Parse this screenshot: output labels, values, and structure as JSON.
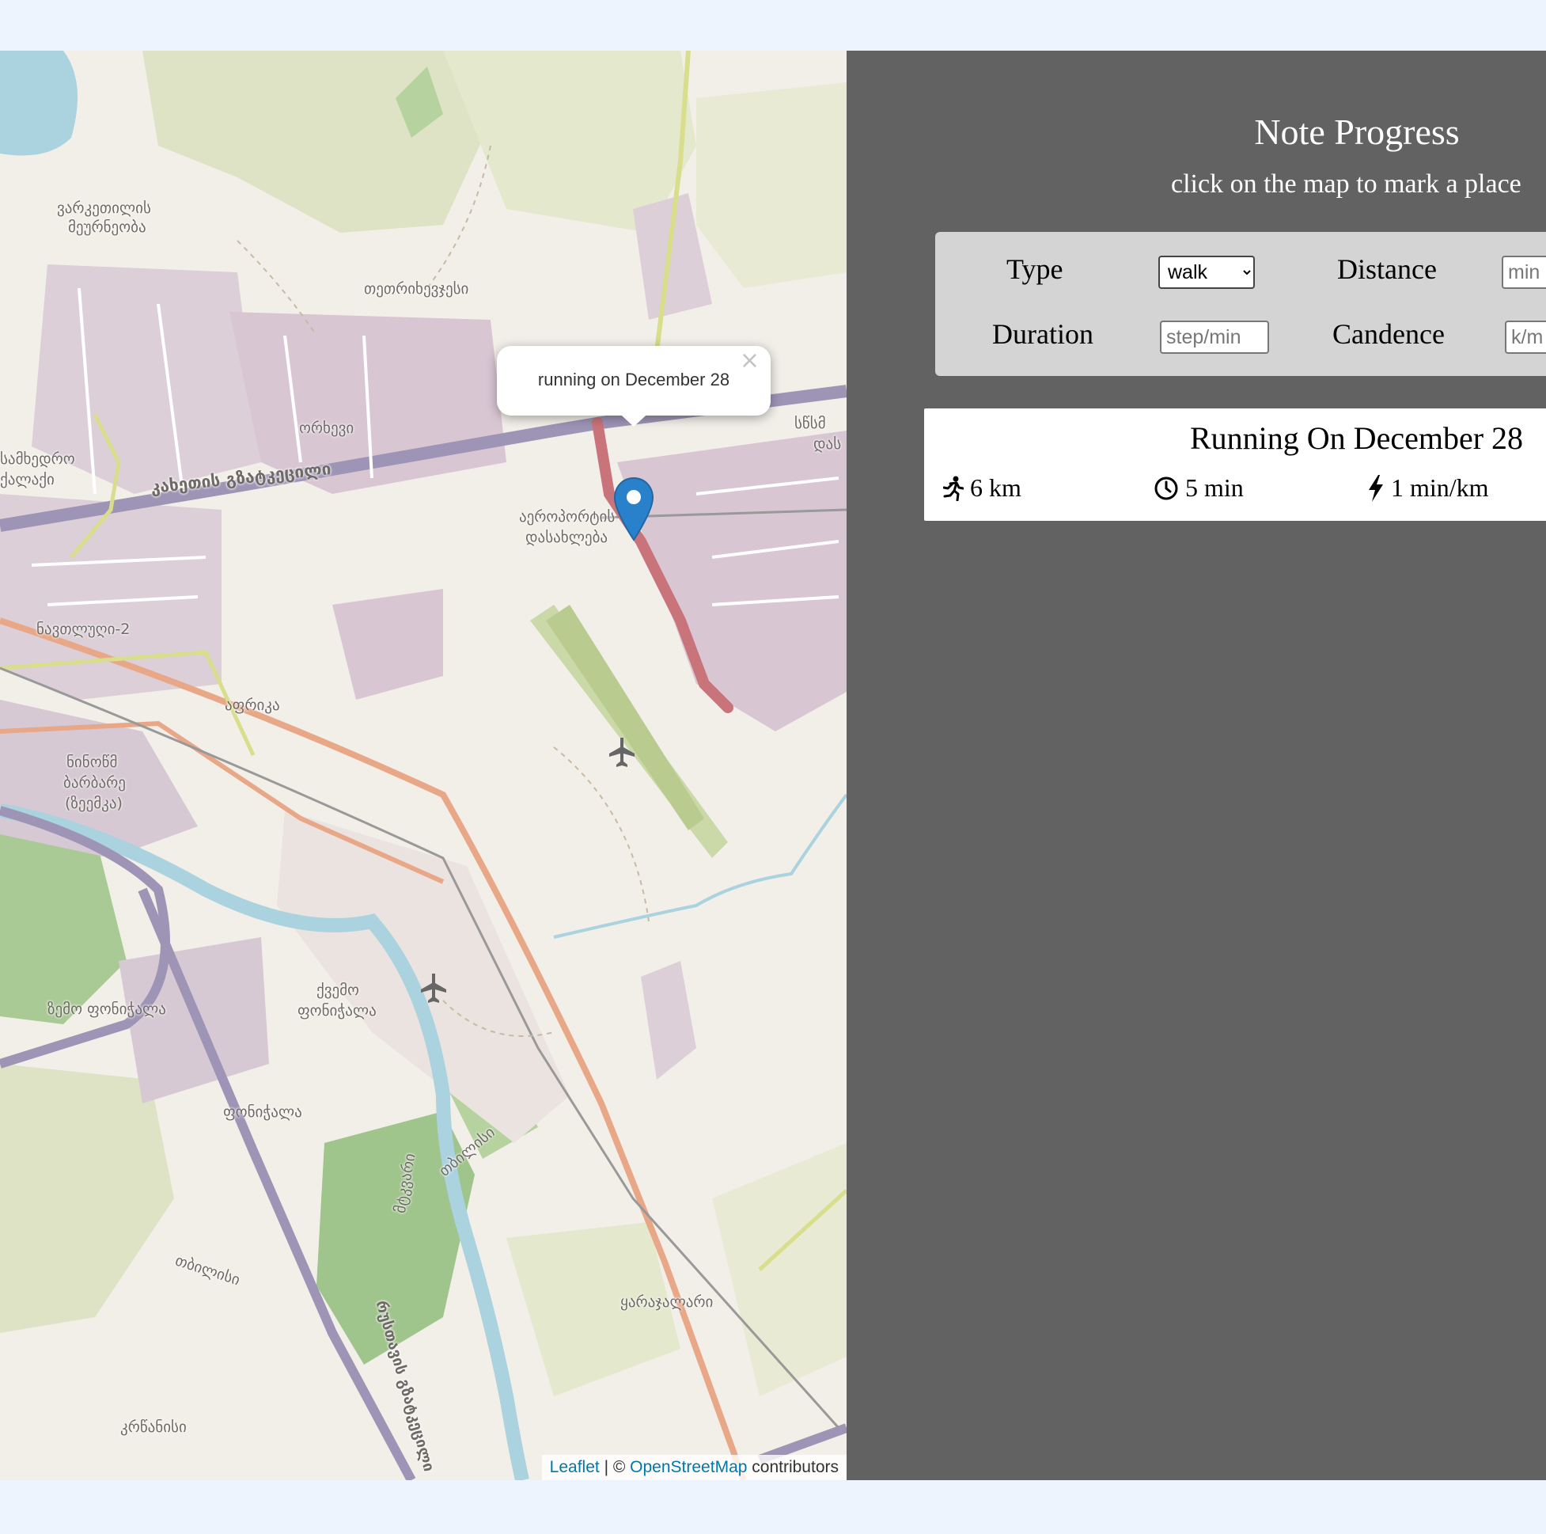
{
  "map": {
    "popup_text": "running on December 28",
    "popup_close": "×",
    "attribution": {
      "leaflet": "Leaflet",
      "separator": " | © ",
      "osm": "OpenStreetMap",
      "suffix": " contributors"
    },
    "labels": {
      "varketili": "ვარკეთილის",
      "varketili2": "მეურნეობა",
      "tetri": "თეთრიხევჯესი",
      "orkhevi": "ორხევი",
      "samgori": "სამხედრო",
      "samgori2": "ქალაქი",
      "kakheti": "კახეთის გზატკეცილი",
      "airport": "აეროპორტის",
      "airport2": "დასახლება",
      "navtlughi": "ნავთლუღი-2",
      "afrika": "აფრიკა",
      "kvemo": "ქვემო",
      "kvemo2": "ფონიჭალა",
      "zemo": "ზემო ფონიჭალა",
      "ponichala": "ფონიჭალა",
      "mtkvari": "მტკვარი",
      "tbilisi": "თბილისი",
      "karajalari": "ყარაჯალარი",
      "krtsanisi": "კრწანისი",
      "rustavi": "რუსთავის გზატკეცილი",
      "satsmo": "სწსმ",
      "das": "დას",
      "lilo": "ნინოწმ",
      "lilo2": "ბარბარე",
      "lilo3": "(ზეემკა)",
      "tbilisi_river": "თბილისი"
    }
  },
  "sidebar": {
    "title": "Note Progress",
    "subtitle": "click on the map to mark a place",
    "form": {
      "type_label": "Type",
      "type_value": "walk",
      "distance_label": "Distance",
      "distance_placeholder": "min",
      "duration_label": "Duration",
      "duration_placeholder": "step/min",
      "cadence_label": "Candence",
      "cadence_placeholder": "k/m"
    },
    "workout": {
      "title": "Running On December 28",
      "distance": "6 km",
      "duration": "5 min",
      "pace": "1 min/km"
    }
  },
  "colors": {
    "page_bg": "#eef4fd",
    "sidebar_bg": "#616261",
    "form_bg": "#d4d4d4",
    "marker_blue": "#2a81cb",
    "route_red": "#c9747a"
  },
  "icons": [
    "runner-icon",
    "clock-icon",
    "lightning-icon",
    "map-marker-icon",
    "airport-icon",
    "close-icon"
  ]
}
